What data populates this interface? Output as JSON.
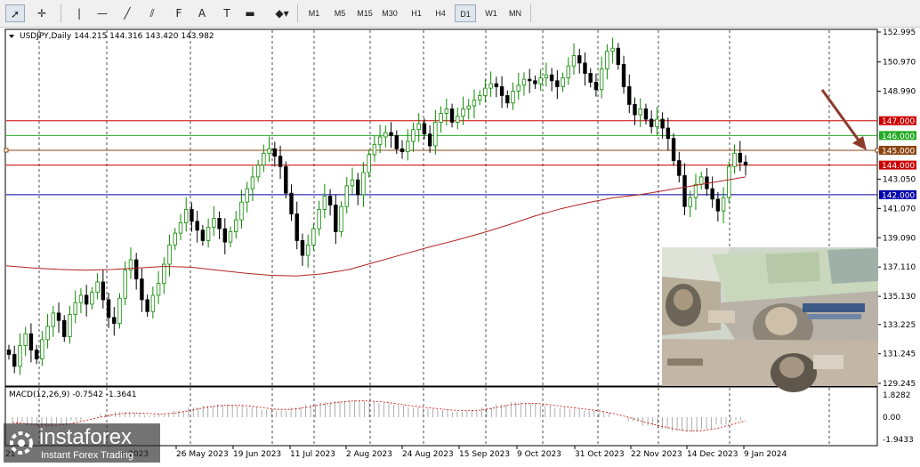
{
  "toolbar": {
    "tools": [
      {
        "name": "cursor-icon",
        "glyph": "➚"
      },
      {
        "name": "crosshair-icon",
        "glyph": "✛"
      },
      {
        "name": "vertical-line-icon",
        "glyph": "|"
      },
      {
        "name": "horizontal-line-icon",
        "glyph": "—"
      },
      {
        "name": "trendline-icon",
        "glyph": "╱"
      },
      {
        "name": "equidistant-channel-icon",
        "glyph": "⫽"
      },
      {
        "name": "fibonacci-icon",
        "glyph": "F"
      },
      {
        "name": "text-icon",
        "glyph": "A"
      },
      {
        "name": "text-label-icon",
        "glyph": "T"
      },
      {
        "name": "rectangle-icon",
        "glyph": "▬"
      },
      {
        "name": "shapes-dropdown-icon",
        "glyph": "◆▾"
      }
    ],
    "timeframes": [
      "M1",
      "M5",
      "M15",
      "M30",
      "H1",
      "H4",
      "D1",
      "W1",
      "MN"
    ],
    "active_timeframe": "D1"
  },
  "chart": {
    "header": "USDJPY,Daily  144.215 144.316 143.420 143.982",
    "price_axis": [
      "152.995",
      "150.970",
      "148.990",
      "147.000",
      "146.000",
      "145.000",
      "144.000",
      "143.050",
      "142.000",
      "141.070",
      "139.090",
      "137.110",
      "135.130",
      "133.225",
      "131.245",
      "129.245"
    ],
    "date_axis": [
      "26 May 2023",
      "19 Jun 2023",
      "11 Jul 2023",
      "2 Aug 2023",
      "24 Aug 2023",
      "15 Sep 2023",
      "9 Oct 2023",
      "31 Oct 2023",
      "22 Nov 2023",
      "14 Dec 2023",
      "9 Jan 2024"
    ],
    "date_axis_partial": [
      "21 ",
      "y 2023"
    ],
    "levels": [
      {
        "label": "147.000",
        "value": 147.0,
        "color": "#cc0000"
      },
      {
        "label": "146.000",
        "value": 146.0,
        "color": "#22aa22"
      },
      {
        "label": "145.000",
        "value": 145.0,
        "color": "#8b4513"
      },
      {
        "label": "144.000",
        "value": 144.0,
        "color": "#cc0000"
      },
      {
        "label": "142.000",
        "value": 142.0,
        "color": "#0000aa"
      }
    ],
    "candles_close": [
      131.2,
      130.4,
      131.8,
      132.6,
      131.5,
      130.9,
      132.2,
      133.1,
      134.0,
      133.5,
      132.4,
      133.9,
      134.7,
      135.2,
      134.6,
      135.4,
      136.1,
      134.9,
      133.7,
      133.3,
      135.0,
      136.9,
      137.6,
      136.3,
      134.9,
      134.1,
      135.2,
      136.0,
      137.3,
      138.6,
      139.4,
      140.1,
      141.0,
      140.2,
      139.6,
      138.9,
      139.8,
      140.4,
      139.7,
      138.8,
      139.5,
      140.3,
      141.5,
      142.4,
      143.2,
      144.0,
      144.8,
      145.1,
      144.6,
      143.9,
      142.1,
      140.7,
      138.9,
      137.9,
      138.6,
      139.7,
      141.0,
      141.9,
      141.3,
      139.5,
      141.2,
      142.6,
      143.0,
      142.0,
      143.5,
      144.7,
      145.4,
      145.9,
      146.2,
      146.0,
      145.1,
      144.9,
      145.6,
      146.4,
      146.8,
      146.1,
      145.3,
      146.9,
      147.5,
      147.8,
      146.9,
      147.3,
      147.8,
      148.0,
      148.4,
      148.7,
      149.2,
      149.5,
      149.3,
      148.7,
      148.2,
      149.0,
      149.4,
      149.8,
      149.7,
      149.5,
      149.9,
      150.1,
      149.7,
      149.3,
      149.9,
      150.7,
      151.4,
      150.9,
      150.2,
      149.6,
      149.1,
      150.5,
      151.7,
      151.9,
      150.8,
      149.3,
      148.1,
      147.4,
      147.8,
      147.1,
      146.6,
      147.1,
      146.5,
      145.8,
      144.3,
      143.3,
      141.2,
      141.8,
      142.7,
      143.2,
      142.4,
      141.7,
      140.9,
      141.8,
      143.9,
      144.8,
      144.2,
      144.0
    ],
    "ma_values": [
      137.2,
      137.05,
      136.95,
      136.9,
      136.95,
      137.05,
      137.15,
      137.1,
      136.9,
      136.7,
      136.55,
      136.5,
      136.65,
      136.95,
      137.45,
      137.95,
      138.45,
      138.9,
      139.4,
      139.95,
      140.55,
      141.05,
      141.45,
      141.8,
      142.0,
      142.3,
      142.6,
      142.9,
      143.2
    ],
    "macd_label": "MACD(12,26,9) -0.7542 -1.3641",
    "macd_axis": [
      "1.8282",
      "0.00",
      "-1.9433"
    ],
    "macd_hist": [
      -0.5,
      -0.8,
      -0.9,
      -0.6,
      -0.3,
      0.0,
      0.3,
      0.5,
      0.4,
      0.2,
      0.3,
      0.6,
      0.9,
      1.1,
      1.2,
      1.1,
      0.9,
      0.7,
      0.6,
      0.9,
      1.2,
      1.4,
      1.5,
      1.6,
      1.5,
      1.3,
      1.1,
      0.9,
      0.8,
      0.7,
      0.5,
      0.6,
      0.9,
      1.2,
      1.4,
      1.3,
      1.1,
      0.9,
      0.8,
      0.6,
      0.4,
      0.0,
      -0.4,
      -0.8,
      -1.1,
      -1.3,
      -1.4,
      -1.1,
      -0.7,
      -0.3,
      0.0
    ],
    "watermark_brand": "instaforex",
    "watermark_sub": "Instant Forex Trading"
  },
  "colors": {
    "bull": "#0d8a00",
    "bear": "#000000",
    "ma": "#b22222",
    "grid": "#000000",
    "arrow": "#8b3a2c"
  }
}
